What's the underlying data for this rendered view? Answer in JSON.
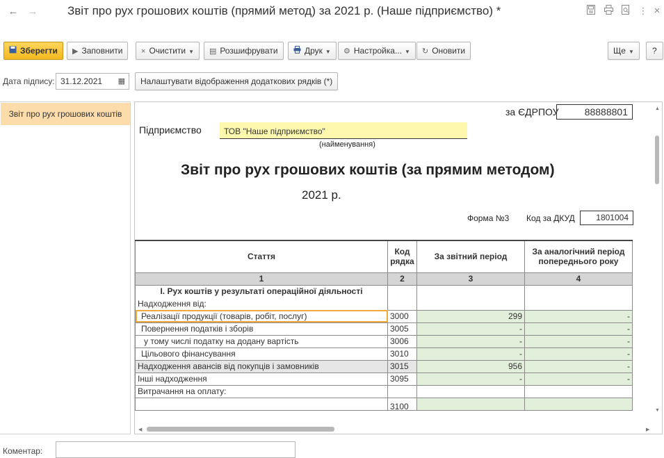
{
  "window": {
    "title": "Звіт про рух грошових коштів (прямий метод) за 2021 р. (Наше підприємство) *",
    "nav_back": "←",
    "nav_forward": "→",
    "title_icons": [
      "save-icon",
      "print-icon",
      "preview-icon",
      "more-icon",
      "close-icon"
    ],
    "more_glyph": "⋮",
    "close_glyph": "×"
  },
  "toolbar": {
    "save": "Зберегти",
    "fill": "Заповнити",
    "clear": "Очистити",
    "decode": "Розшифрувати",
    "print": "Друк",
    "settings": "Настройка...",
    "refresh": "Оновити",
    "more": "Ще",
    "help": "?"
  },
  "signing": {
    "label": "Дата підпису:",
    "date": "31.12.2021",
    "extra_rows_button": "Налаштувати відображення додаткових рядків (*)"
  },
  "sidebar": {
    "items": [
      {
        "label": "Звіт про рух грошових коштів"
      }
    ]
  },
  "report": {
    "edrpou_label": "за ЄДРПОУ",
    "edrpou": "88888801",
    "enterprise_label": "Підприємство",
    "enterprise_name": "ТОВ \"Наше підприємство\"",
    "enterprise_caption": "(найменування)",
    "heading": "Звіт про рух грошових коштів (за прямим методом)",
    "period": "2021 р.",
    "form_label": "Форма №3",
    "dkud_label": "Код за ДКУД",
    "dkud": "1801004",
    "columns": [
      "Стаття",
      "Код рядка",
      "За звітний період",
      "За аналогічний період попереднього року"
    ],
    "column_numbers": [
      "1",
      "2",
      "3",
      "4"
    ],
    "section1": "І. Рух коштів у результаті операційної діяльності",
    "receipts_label": "Надходження від:",
    "rows": [
      {
        "name": "Реалізації продукції (товарів, робіт, послуг)",
        "code": "3000",
        "current": "299",
        "previous": "-"
      },
      {
        "name": "Повернення податків і зборів",
        "code": "3005",
        "current": "-",
        "previous": "-"
      },
      {
        "name": "у тому числі податку на додану вартість",
        "code": "3006",
        "current": "-",
        "previous": "-"
      },
      {
        "name": "Цільового фінансування",
        "code": "3010",
        "current": "-",
        "previous": "-"
      },
      {
        "name": "Надходження авансів від покупців і замовників",
        "code": "3015",
        "current": "956",
        "previous": "-"
      },
      {
        "name": "Інші надходження",
        "code": "3095",
        "current": "-",
        "previous": "-"
      }
    ],
    "payments_label": "Витрачання на оплату:",
    "partial_code": "3100"
  },
  "comment": {
    "label": "Коментар:",
    "value": ""
  }
}
